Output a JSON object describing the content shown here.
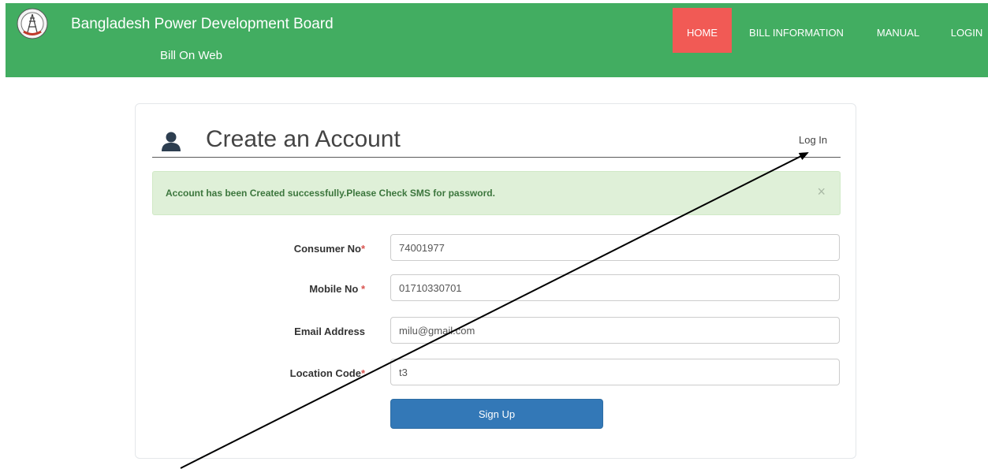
{
  "header": {
    "title": "Bangladesh Power Development Board",
    "subtitle": "Bill On Web",
    "logo_icon": "bpdb-seal-logo"
  },
  "nav": {
    "home": "HOME",
    "bill_information": "BILL INFORMATION",
    "manual": "MANUAL",
    "login": "LOGIN"
  },
  "panel": {
    "title": "Create an Account",
    "login_link": "Log In",
    "user_icon": "user-icon"
  },
  "alert": {
    "message": "Account has been Created successfully.Please Check SMS for password.",
    "close": "×"
  },
  "form": {
    "consumer_no": {
      "label": "Consumer No",
      "required": "*",
      "value": "74001977"
    },
    "mobile_no": {
      "label": "Mobile No ",
      "required": "*",
      "value": "01710330701"
    },
    "email": {
      "label": "Email Address",
      "value": "milu@gmail.com"
    },
    "location_code": {
      "label": "Location Code",
      "required": "*",
      "value": "t3"
    },
    "submit": "Sign Up"
  },
  "colors": {
    "navbar": "#42ad61",
    "nav_active": "#f15a55",
    "button": "#3378b7",
    "alert_bg": "#dff0d8",
    "alert_text": "#3c763d"
  }
}
